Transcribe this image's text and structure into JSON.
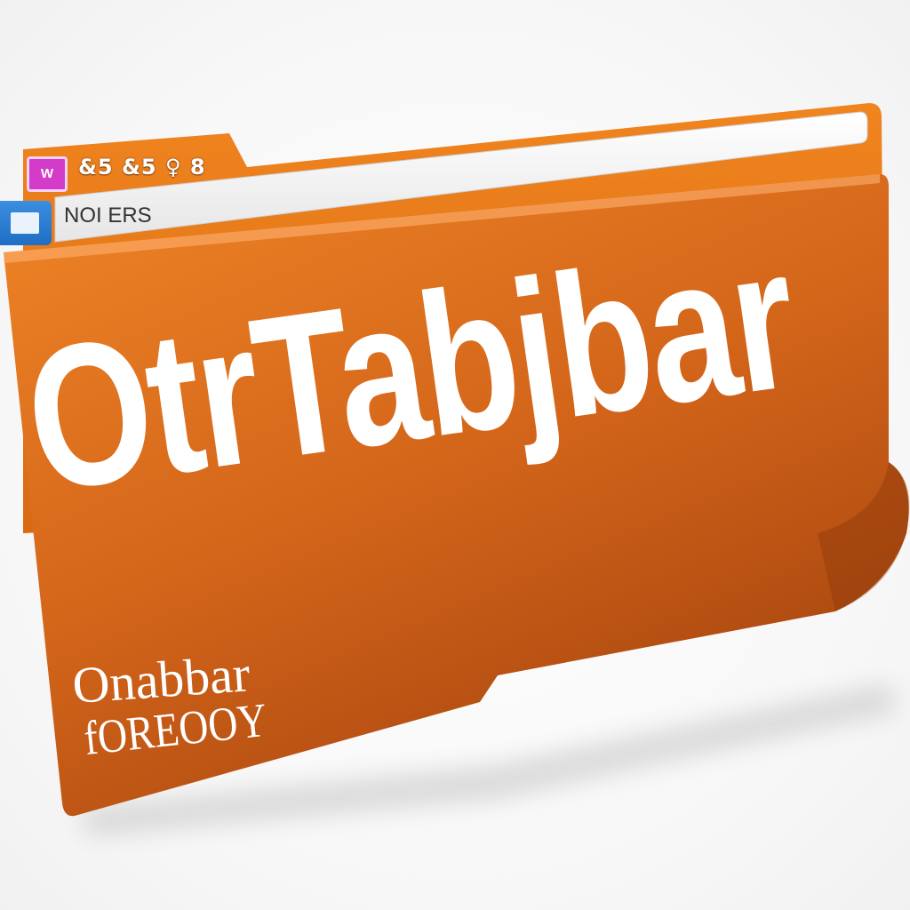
{
  "colors": {
    "folder_orange": "#e87a1c",
    "folder_dark": "#b04a10",
    "address_bar": "#f3f3f3",
    "badge_pink": "#d23cc8",
    "tab_blue": "#2a7fd6"
  },
  "folder": {
    "icon": "folder-icon",
    "badge_text": "W",
    "tab_glyphs": "&5 &5 ♀ 8",
    "address_text": "NOI ERS",
    "title": "OtrTabjbar",
    "subtitle_line1": "Onabbar",
    "subtitle_line2": "fOREOOY"
  }
}
